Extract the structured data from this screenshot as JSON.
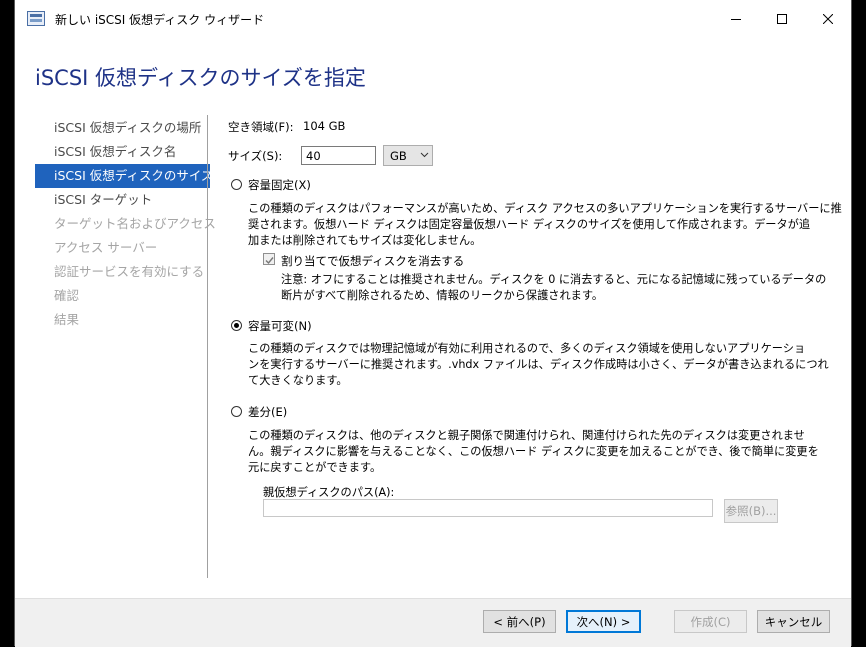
{
  "window": {
    "title": "新しい iSCSI 仮想ディスク ウィザード",
    "icon": "iscsi-wizard-icon",
    "controls": [
      "minimize-icon",
      "maximize-icon",
      "close-icon"
    ]
  },
  "header": {
    "title": "iSCSI 仮想ディスクのサイズを指定"
  },
  "nav": {
    "items": [
      {
        "label": "iSCSI 仮想ディスクの場所"
      },
      {
        "label": "iSCSI 仮想ディスク名"
      },
      {
        "label": "iSCSI 仮想ディスクのサイズ"
      },
      {
        "label": "iSCSI ターゲット"
      },
      {
        "label": "ターゲット名およびアクセス"
      },
      {
        "label": "アクセス サーバー"
      },
      {
        "label": "認証サービスを有効にする"
      },
      {
        "label": "確認"
      },
      {
        "label": "結果"
      }
    ]
  },
  "form": {
    "free_space_label": "空き領域(F):",
    "free_space_value": "104 GB",
    "size_label": "サイズ(S):",
    "size_value": "40",
    "unit_value": "GB",
    "fixed": {
      "label": "容量固定(X)",
      "selected": false,
      "desc_line1": "この種類のディスクはパフォーマンスが高いため、ディスク アクセスの多いアプリケーションを実行するサーバーに推",
      "desc_line2": "奨されます。仮想ハード ディスクは固定容量仮想ハード ディスクのサイズを使用して作成されます。データが追",
      "desc_line3": "加または削除されてもサイズは変化しません。",
      "checkbox_label": "割り当てで仮想ディスクを消去する",
      "checkbox_checked": true,
      "note_line1": "注意: オフにすることは推奨されません。ディスクを 0 に消去すると、元になる記憶域に残っているデータの",
      "note_line2": "断片がすべて削除されるため、情報のリークから保護されます。"
    },
    "dynamic": {
      "label": "容量可変(N)",
      "selected": true,
      "desc_line1": "この種類のディスクでは物理記憶域が有効に利用されるので、多くのディスク領域を使用しないアプリケーショ",
      "desc_line2": "ンを実行するサーバーに推奨されます。.vhdx ファイルは、ディスク作成時は小さく、データが書き込まれるにつれ",
      "desc_line3": "て大きくなります。"
    },
    "differencing": {
      "label": "差分(E)",
      "selected": false,
      "desc_line1": "この種類のディスクは、他のディスクと親子関係で関連付けられ、関連付けられた先のディスクは変更されませ",
      "desc_line2": "ん。親ディスクに影響を与えることなく、この仮想ハード ディスクに変更を加えることができ、後で簡単に変更を",
      "desc_line3": "元に戻すことができます。",
      "parent_path_label": "親仮想ディスクのパス(A):",
      "parent_path_value": "",
      "browse_label": "参照(B)..."
    }
  },
  "footer": {
    "back_label": "< 前へ(P)",
    "next_label": "次へ(N) >",
    "create_label": "作成(C)",
    "cancel_label": "キャンセル"
  },
  "colors": {
    "heading": "#1e3287",
    "nav_active_bg": "#1f63bd",
    "disabled_text": "#a5a5a5",
    "focus_border": "#0078d7"
  }
}
